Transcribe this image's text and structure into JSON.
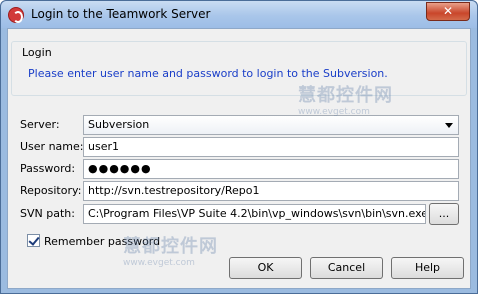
{
  "window": {
    "title": "Login to the Teamwork Server",
    "close_glyph": "✕"
  },
  "login_group": {
    "title": "Login",
    "message": "Please enter user name and password to login to the Subversion."
  },
  "form": {
    "server_label": "Server:",
    "server_value": "Subversion",
    "username_label": "User name:",
    "username_value": "user1",
    "password_label": "Password:",
    "password_value": "●●●●●●",
    "repository_label": "Repository:",
    "repository_value": "http://svn.testrepository/Repo1",
    "svnpath_label": "SVN path:",
    "svnpath_value": "C:\\Program Files\\VP Suite 4.2\\bin\\vp_windows\\svn\\bin\\svn.exe",
    "browse_label": "..."
  },
  "remember": {
    "label": "Remember password",
    "checked": true
  },
  "buttons": {
    "ok": "OK",
    "cancel": "Cancel",
    "help": "Help"
  },
  "watermarks": {
    "top_main": "慧都控件网",
    "top_sub": "www.evget.com",
    "bottom_main": "慧都控件网",
    "bottom_sub": "www.evget.com"
  }
}
